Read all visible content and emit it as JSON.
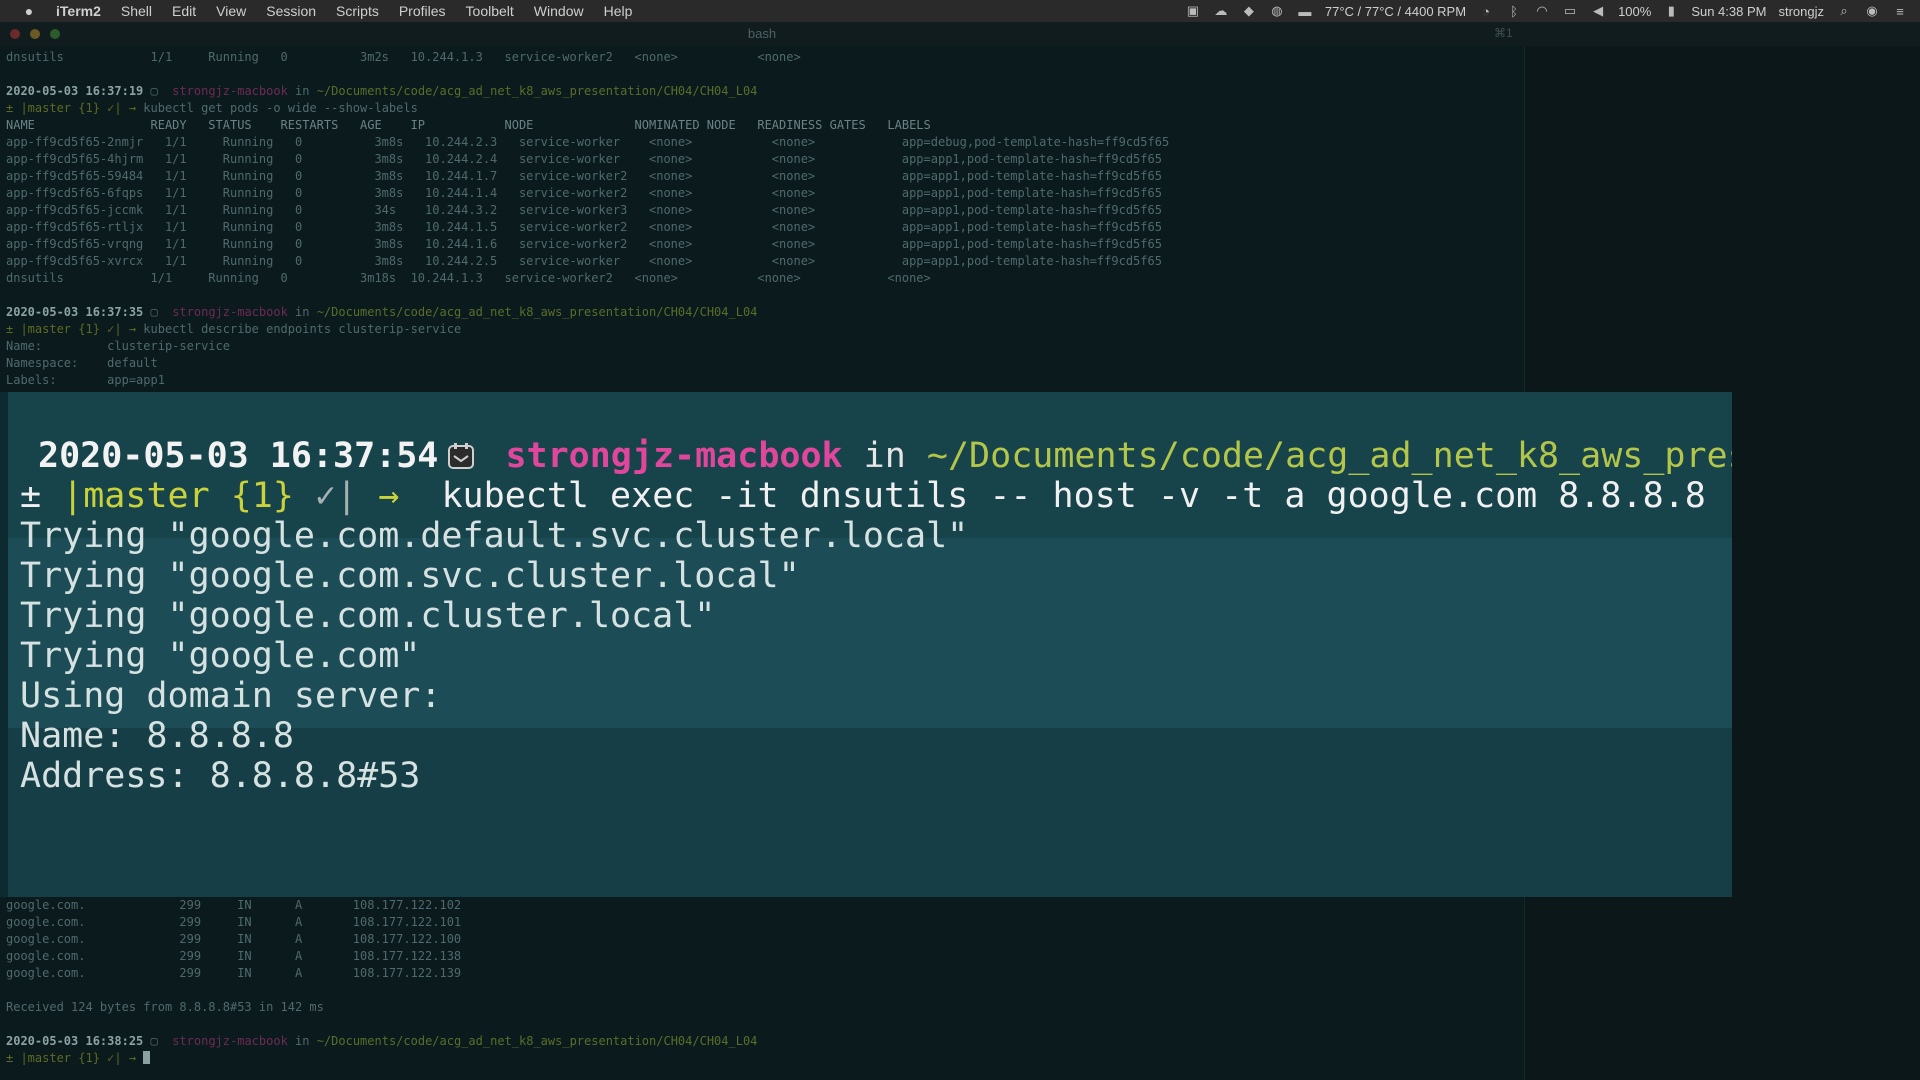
{
  "menubar": {
    "app_name": "iTerm2",
    "items": [
      "Shell",
      "Edit",
      "View",
      "Session",
      "Scripts",
      "Profiles",
      "Toolbelt",
      "Window",
      "Help"
    ],
    "temp": "77°C / 77°C / 4400 RPM",
    "battery": "100%",
    "clock": "Sun 4:38 PM",
    "user": "strongjz"
  },
  "window": {
    "title": "bash",
    "shortcut": "⌘1"
  },
  "terminal": {
    "top_row": "dnsutils            1/1     Running   0          3m2s   10.244.1.3   service-worker2   <none>           <none>",
    "block1": {
      "timestamp": "2020-05-03 16:37:19",
      "host": "strongjz-macbook",
      "in": " in ",
      "path": "~/Documents/code/acg_ad_net_k8_aws_presentation/CH04/CH04_L04",
      "prompt": "± |master {1} ✓| → ",
      "command": "kubectl get pods -o wide --show-labels",
      "header": "NAME                READY   STATUS    RESTARTS   AGE    IP           NODE              NOMINATED NODE   READINESS GATES   LABELS",
      "rows": [
        "app-ff9cd5f65-2nmjr   1/1     Running   0          3m8s   10.244.2.3   service-worker    <none>           <none>            app=debug,pod-template-hash=ff9cd5f65",
        "app-ff9cd5f65-4hjrm   1/1     Running   0          3m8s   10.244.2.4   service-worker    <none>           <none>            app=app1,pod-template-hash=ff9cd5f65",
        "app-ff9cd5f65-59484   1/1     Running   0          3m8s   10.244.1.7   service-worker2   <none>           <none>            app=app1,pod-template-hash=ff9cd5f65",
        "app-ff9cd5f65-6fqps   1/1     Running   0          3m8s   10.244.1.4   service-worker2   <none>           <none>            app=app1,pod-template-hash=ff9cd5f65",
        "app-ff9cd5f65-jccmk   1/1     Running   0          34s    10.244.3.2   service-worker3   <none>           <none>            app=app1,pod-template-hash=ff9cd5f65",
        "app-ff9cd5f65-rtljx   1/1     Running   0          3m8s   10.244.1.5   service-worker2   <none>           <none>            app=app1,pod-template-hash=ff9cd5f65",
        "app-ff9cd5f65-vrqng   1/1     Running   0          3m8s   10.244.1.6   service-worker2   <none>           <none>            app=app1,pod-template-hash=ff9cd5f65",
        "app-ff9cd5f65-xvrcx   1/1     Running   0          3m8s   10.244.2.5   service-worker    <none>           <none>            app=app1,pod-template-hash=ff9cd5f65",
        "dnsutils            1/1     Running   0          3m18s  10.244.1.3   service-worker2   <none>           <none>            <none>"
      ]
    },
    "block2": {
      "timestamp": "2020-05-03 16:37:35",
      "host": "strongjz-macbook",
      "in": " in ",
      "path": "~/Documents/code/acg_ad_net_k8_aws_presentation/CH04/CH04_L04",
      "prompt": "± |master {1} ✓| → ",
      "command": "kubectl describe endpoints clusterip-service",
      "rows": [
        "Name:         clusterip-service",
        "Namespace:    default",
        "Labels:       app=app1"
      ]
    },
    "answer_rows": [
      "google.com.             299     IN      A       108.177.122.102",
      "google.com.             299     IN      A       108.177.122.101",
      "google.com.             299     IN      A       108.177.122.100",
      "google.com.             299     IN      A       108.177.122.138",
      "google.com.             299     IN      A       108.177.122.139"
    ],
    "received": "Received 124 bytes from 8.8.8.8#53 in 142 ms",
    "block3": {
      "timestamp": "2020-05-03 16:38:25",
      "host": "strongjz-macbook",
      "in": " in ",
      "path": "~/Documents/code/acg_ad_net_k8_aws_presentation/CH04/CH04_L04",
      "prompt": "± |master {1} ✓| → "
    }
  },
  "zoom": {
    "timestamp": "2020-05-03 16:37:54",
    "host": "strongjz-macbook",
    "in": " in ",
    "path": "~/Documents/code/acg_ad_net_k8_aws_pres",
    "pm": "± ",
    "branch": "|master {1} ",
    "check": "✓|",
    "arrow": " → ",
    "command": " kubectl exec -it dnsutils -- host -v -t a google.com 8.8.8.8",
    "lines": [
      "Trying \"google.com.default.svc.cluster.local\"",
      "Trying \"google.com.svc.cluster.local\"",
      "Trying \"google.com.cluster.local\"",
      "Trying \"google.com\"",
      "Using domain server:",
      "Name: 8.8.8.8",
      "Address: 8.8.8.8#53"
    ]
  }
}
